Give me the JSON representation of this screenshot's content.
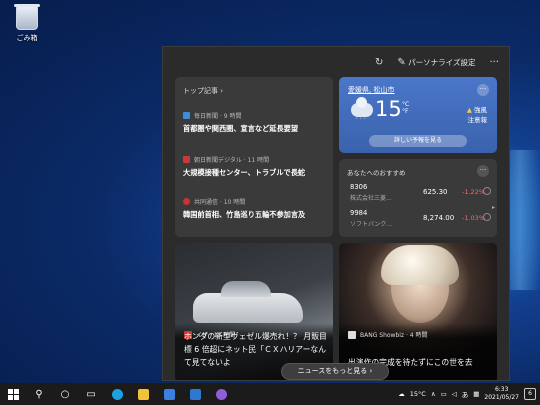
{
  "desktop": {
    "recycle_bin_label": "ごみ箱"
  },
  "panel": {
    "refresh_icon": "refresh-icon",
    "personalize_label": "パーソナライズ設定",
    "more_label": "···"
  },
  "top_stories": {
    "header": "トップ記事 ›",
    "items": [
      {
        "source": "毎日新聞 · 9 時間",
        "title": "首都圏や関西圏、宣言など延長要望",
        "logo_color": "#3a8fd6"
      },
      {
        "source": "朝日新聞デジタル · 11 時間",
        "title": "大規模接種センター、トラブルで長蛇",
        "logo_color": "#c83a3a"
      },
      {
        "source": "共同通信 · 10 時間",
        "title": "韓国前首相、竹島巡り五輪不参加言及",
        "logo_color": "#d03030"
      }
    ]
  },
  "weather": {
    "location": "愛媛県, 松山市",
    "more": "···",
    "rain": "´´´",
    "temperature": "15",
    "unit_c": "°C",
    "unit_f": "°F",
    "warning_icon": "▲",
    "warning_line1": "強風",
    "warning_line2": "注意報",
    "forecast_button": "詳しい予報を見る"
  },
  "stocks": {
    "header": "あなたへのおすすめ",
    "more": "···",
    "arrow": "▸",
    "items": [
      {
        "code": "8306",
        "name": "株式会社三菱...",
        "price": "625.30",
        "change": "-1.22%"
      },
      {
        "code": "9984",
        "name": "ソフトバンク...",
        "price": "8,274.00",
        "change": "-1.03%"
      }
    ]
  },
  "news": [
    {
      "source": "イザ · 13 時間",
      "title": "ホンダの新型ヴェゼル爆売れ！？ 月販目標 6 倍超にネット民「ＣＸハリアーなんて見てないよ",
      "logo_color": "#d8322c"
    },
    {
      "source": "BANG Showbiz · 4 時間",
      "title": "出演作の完成を待たずにこの世を去",
      "logo_color": "#dddddd"
    }
  ],
  "see_more_button": "ニュースをもっと見る ›",
  "taskbar": {
    "weather_temp": "15°C",
    "time": "6:33",
    "date": "2021/05/27",
    "notification_count": "6",
    "ime": "あ"
  },
  "colors": {
    "panel_bg": "#2b2b2b",
    "card_bg": "#3a3a3a",
    "weather_bg": "#4b77c9",
    "negative": "#ff6666",
    "taskbar_bg": "#1b1b1b"
  }
}
